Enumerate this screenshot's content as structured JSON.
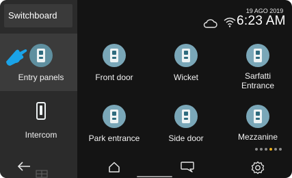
{
  "sidebar": {
    "title": "Switchboard"
  },
  "status": {
    "date": "19 AGO 2019",
    "time": "6:23 AM"
  },
  "tiles": [
    {
      "label": "Entry panels",
      "icon": "entry-panel-icon"
    },
    {
      "label": "Front door",
      "icon": "entry-panel-icon"
    },
    {
      "label": "Wicket",
      "icon": "entry-panel-icon"
    },
    {
      "label": "Sarfatti\nEntrance",
      "icon": "entry-panel-icon"
    },
    {
      "label": "Intercom",
      "icon": "intercom-icon"
    },
    {
      "label": "Park entrance",
      "icon": "entry-panel-icon"
    },
    {
      "label": "Side door",
      "icon": "entry-panel-icon"
    },
    {
      "label": "Mezzanine",
      "icon": "entry-panel-icon"
    }
  ],
  "pager": {
    "pages": 6,
    "active_index": 3
  },
  "nav": {
    "icons": [
      "back-arrow-icon",
      "home-icon",
      "message-icon",
      "gear-icon"
    ]
  },
  "colors": {
    "accent_dot": "#f2b21a",
    "icon_circle": "#7aa7b8",
    "pointer": "#1aa3e8"
  }
}
